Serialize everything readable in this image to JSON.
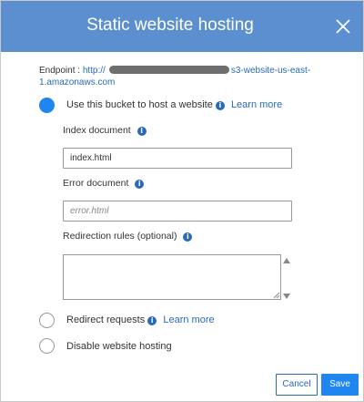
{
  "dialog": {
    "title": "Static website hosting",
    "close_icon": "close-icon"
  },
  "endpoint": {
    "label": "Endpoint : ",
    "url_prefix": "http://",
    "url_suffix": "s3-website-us-east-",
    "url_line2": "1.amazonaws.com"
  },
  "options": {
    "host": {
      "label": "Use this bucket to host a website",
      "learn_more": "Learn more",
      "selected": true
    },
    "redirect": {
      "label": "Redirect requests",
      "learn_more": "Learn more",
      "selected": false
    },
    "disable": {
      "label": "Disable website hosting",
      "selected": false
    }
  },
  "fields": {
    "index_document": {
      "label": "Index document",
      "value": "index.html"
    },
    "error_document": {
      "label": "Error document",
      "placeholder": "error.html",
      "value": ""
    },
    "redirection_rules": {
      "label": "Redirection rules (optional)",
      "value": ""
    }
  },
  "info_glyph": "i",
  "buttons": {
    "cancel": "Cancel",
    "save": "Save"
  },
  "colors": {
    "header": "#5b8fd0",
    "accent": "#1f86f0",
    "link": "#2a6ab8"
  }
}
